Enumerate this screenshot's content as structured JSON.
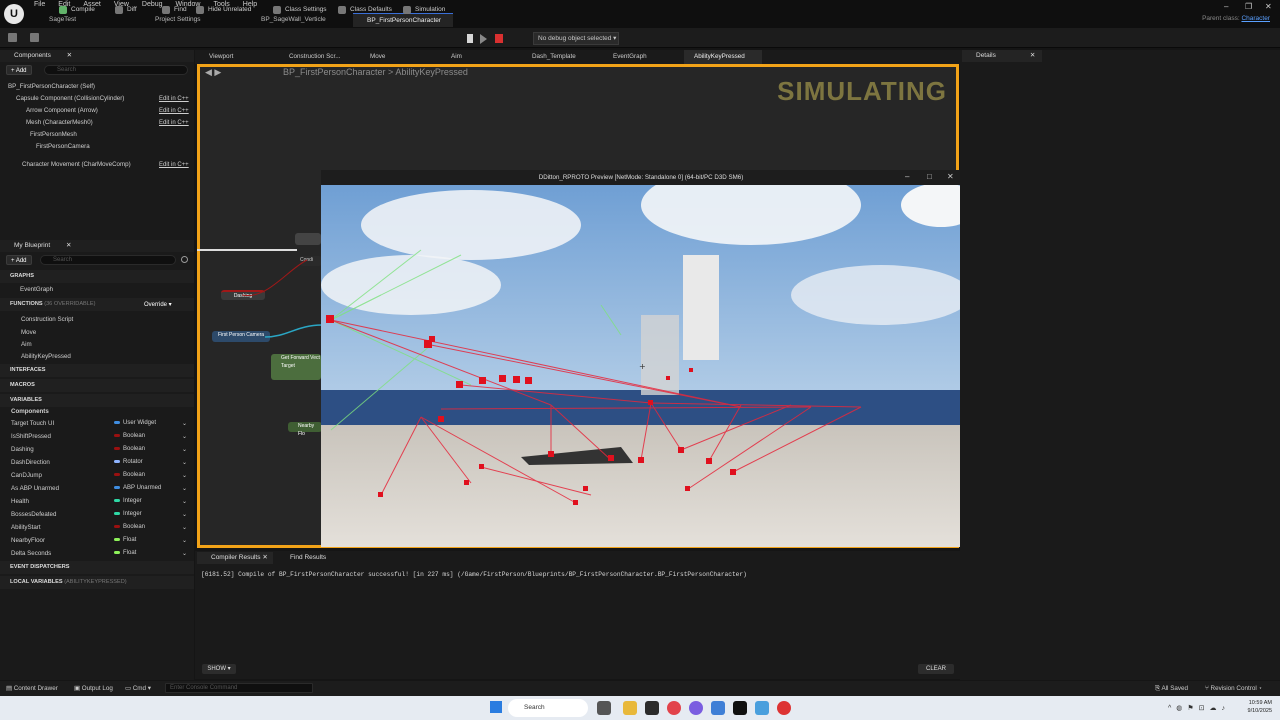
{
  "menu": [
    "File",
    "Edit",
    "Asset",
    "View",
    "Debug",
    "Window",
    "Tools",
    "Help"
  ],
  "doc_tabs": [
    "SageTest",
    "Project Settings",
    "BP_SageWall_Verticle",
    "BP_FirstPersonCharacter"
  ],
  "parent_class": {
    "label": "Parent class:",
    "value": "Character"
  },
  "toolbar": {
    "compile": "Compile",
    "diff": "Diff",
    "find": "Find",
    "hide_unrelated": "Hide Unrelated",
    "class_settings": "Class Settings",
    "class_defaults": "Class Defaults",
    "simulation": "Simulation",
    "debug_object": "No debug object selected"
  },
  "components_panel": {
    "title": "Components",
    "add": "Add",
    "search_placeholder": "Search",
    "items": [
      {
        "label": "BP_FirstPersonCharacter (Self)",
        "edit": ""
      },
      {
        "label": "Capsule Component (CollisionCylinder)",
        "edit": "Edit in C++"
      },
      {
        "label": "Arrow Component (Arrow)",
        "edit": "Edit in C++"
      },
      {
        "label": "Mesh (CharacterMesh0)",
        "edit": "Edit in C++"
      },
      {
        "label": "FirstPersonMesh",
        "edit": ""
      },
      {
        "label": "FirstPersonCamera",
        "edit": ""
      },
      {
        "label": "Character Movement (CharMoveComp)",
        "edit": "Edit in C++"
      }
    ]
  },
  "my_blueprint": {
    "title": "My Blueprint",
    "add": "Add",
    "search_placeholder": "Search",
    "graphs_label": "GRAPHS",
    "event_graph": "EventGraph",
    "functions_label": "FUNCTIONS",
    "functions_sub": "(36 OVERRIDABLE)",
    "override": "Override",
    "functions": [
      "Construction Script",
      "Move",
      "Aim",
      "AbilityKeyPressed"
    ],
    "interfaces": "INTERFACES",
    "macros": "MACROS",
    "variables_label": "VARIABLES",
    "components_label": "Components",
    "variables": [
      {
        "name": "Target Touch UI",
        "type": "User Widget",
        "color": "#3f8de0"
      },
      {
        "name": "IsShiftPressed",
        "type": "Boolean",
        "color": "#9a1010"
      },
      {
        "name": "Dashing",
        "type": "Boolean",
        "color": "#9a1010"
      },
      {
        "name": "DashDirection",
        "type": "Rotator",
        "color": "#8fb4ff"
      },
      {
        "name": "CanDJump",
        "type": "Boolean",
        "color": "#9a1010"
      },
      {
        "name": "As ABP Unarmed",
        "type": "ABP Unarmed",
        "color": "#3f8de0"
      },
      {
        "name": "Health",
        "type": "Integer",
        "color": "#2fd9a6"
      },
      {
        "name": "BossesDefeated",
        "type": "Integer",
        "color": "#2fd9a6"
      },
      {
        "name": "AbilityStart",
        "type": "Boolean",
        "color": "#9a1010"
      },
      {
        "name": "NearbyFloor",
        "type": "Float",
        "color": "#8ef25a"
      },
      {
        "name": "Delta Seconds",
        "type": "Float",
        "color": "#8ef25a"
      }
    ],
    "event_dispatchers": "EVENT DISPATCHERS",
    "local_variables": "LOCAL VARIABLES",
    "local_sub": "(ABILITYKEYPRESSED)"
  },
  "editor_tabs": [
    "Viewport",
    "Construction Scr...",
    "Move",
    "Aim",
    "Dash_Template",
    "EventGraph",
    "AbilityKeyPressed"
  ],
  "breadcrumb": {
    "root": "BP_FirstPersonCharacter",
    "leaf": "AbilityKeyPressed"
  },
  "simulating": "SIMULATING",
  "nodes": {
    "dashing": "Dashing",
    "camera": "First Person Camera",
    "forward": "Get Forward Vect",
    "target": "Target",
    "nearby": "Nearby Flo",
    "cond": "Condi"
  },
  "preview_title": "DDitton_RPROTO Preview [NetMode: Standalone 0]  (64-bit/PC D3D SM6)",
  "details": "Details",
  "bottom_tabs": {
    "compiler": "Compiler Results",
    "find": "Find Results"
  },
  "log": "[6181.52] Compile of BP_FirstPersonCharacter successful! [in 227 ms] (/Game/FirstPerson/Blueprints/BP_FirstPersonCharacter.BP_FirstPersonCharacter)",
  "show": "SHOW",
  "clear": "CLEAR",
  "statusbar": {
    "content_drawer": "Content Drawer",
    "output_log": "Output Log",
    "cmd": "Cmd",
    "console_placeholder": "Enter Console Command",
    "all_saved": "All Saved",
    "revision": "Revision Control"
  },
  "taskbar": {
    "search": "Search",
    "time": "10:59 AM",
    "date": "9/10/2025"
  }
}
